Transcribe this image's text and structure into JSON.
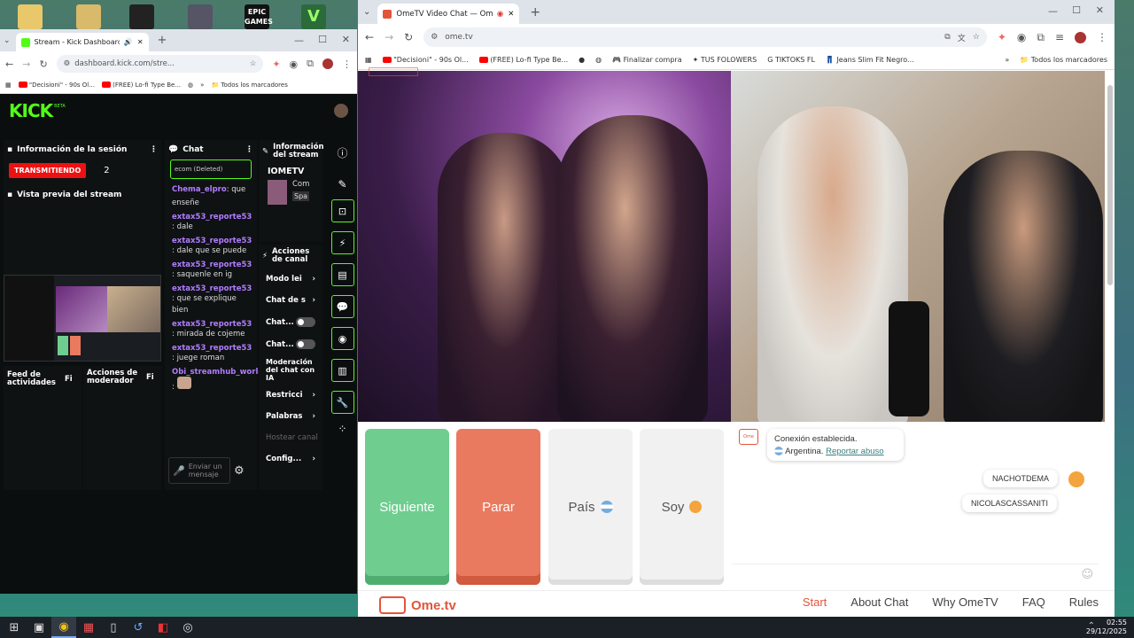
{
  "taskbar": {
    "time": "02:55",
    "date": "29/12/2025"
  },
  "kick_browser": {
    "tab_title": "Stream - Kick Dashboard",
    "url": "dashboard.kick.com/stre...",
    "bookmarks": [
      "\"Decisioni\" - 90s Ol...",
      "(FREE) Lo-fi Type Be...",
      "Todos los marcadores"
    ],
    "logo": "KICK",
    "session": {
      "title": "Información de la sesión",
      "status": "TRANSMITIENDO",
      "viewers": "2",
      "preview_title": "Vista previa del stream"
    },
    "chat": {
      "title": "Chat",
      "top_fragment": "ecom (Deleted)",
      "messages": [
        {
          "user": "Chema_elpro",
          "text": ": que enseñe"
        },
        {
          "user": "extax53_reporte53",
          "text": ": dale"
        },
        {
          "user": "extax53_reporte53",
          "text": ": dale que se puede"
        },
        {
          "user": "extax53_reporte53",
          "text": ": saquenle en ig"
        },
        {
          "user": "extax53_reporte53",
          "text": ": que se explique bien"
        },
        {
          "user": "extax53_reporte53",
          "text": ": mirada de cojeme"
        },
        {
          "user": "extax53_reporte53",
          "text": ": juege roman"
        },
        {
          "user": "Obi_streamhub_world",
          "text": ":"
        }
      ],
      "send_placeholder": "Enviar un mensaje"
    },
    "stream_info": {
      "title": "Información del stream",
      "channel": "IOMETV",
      "line1": "Com",
      "line2": "Spa"
    },
    "channel_actions": {
      "title": "Acciones de canal",
      "items": [
        "Modo lei",
        "Chat de s",
        "Chat...",
        "Chat...",
        "Moderación del chat con IA",
        "Restricci",
        "Palabras",
        "Config..."
      ],
      "host_placeholder": "Hostear canal"
    },
    "feed": {
      "title": "Feed de actividades",
      "filter": "Fi"
    },
    "mod_actions": {
      "title": "Acciones de moderador",
      "filter": "Fi"
    }
  },
  "ome_browser": {
    "tab_title": "OmeTV Video Chat — Ome",
    "url": "ome.tv",
    "bookmarks": [
      "\"Decisioni\" - 90s Ol...",
      "(FREE) Lo-fi Type Be...",
      "Finalizar compra",
      "TUS FOLOWERS",
      "TIKTOKS FL",
      "Jeans Slim Fit Negro...",
      "Todos los marcadores"
    ],
    "buttons": {
      "next": "Siguiente",
      "stop": "Parar",
      "country": "País",
      "gender": "Soy"
    },
    "chat": {
      "connected": "Conexión establecida.",
      "country": "Argentina.",
      "report": "Reportar abuso",
      "msg1": "NACHOTDEMA",
      "msg2": "NICOLASCASSANITI"
    },
    "footer": {
      "logo": "Ome.tv",
      "nav": [
        "Start",
        "About Chat",
        "Why OmeTV",
        "FAQ",
        "Rules"
      ]
    },
    "colors": {
      "next": "#6fce8f",
      "stop": "#ea7a5f",
      "accent": "#e2553a"
    }
  }
}
